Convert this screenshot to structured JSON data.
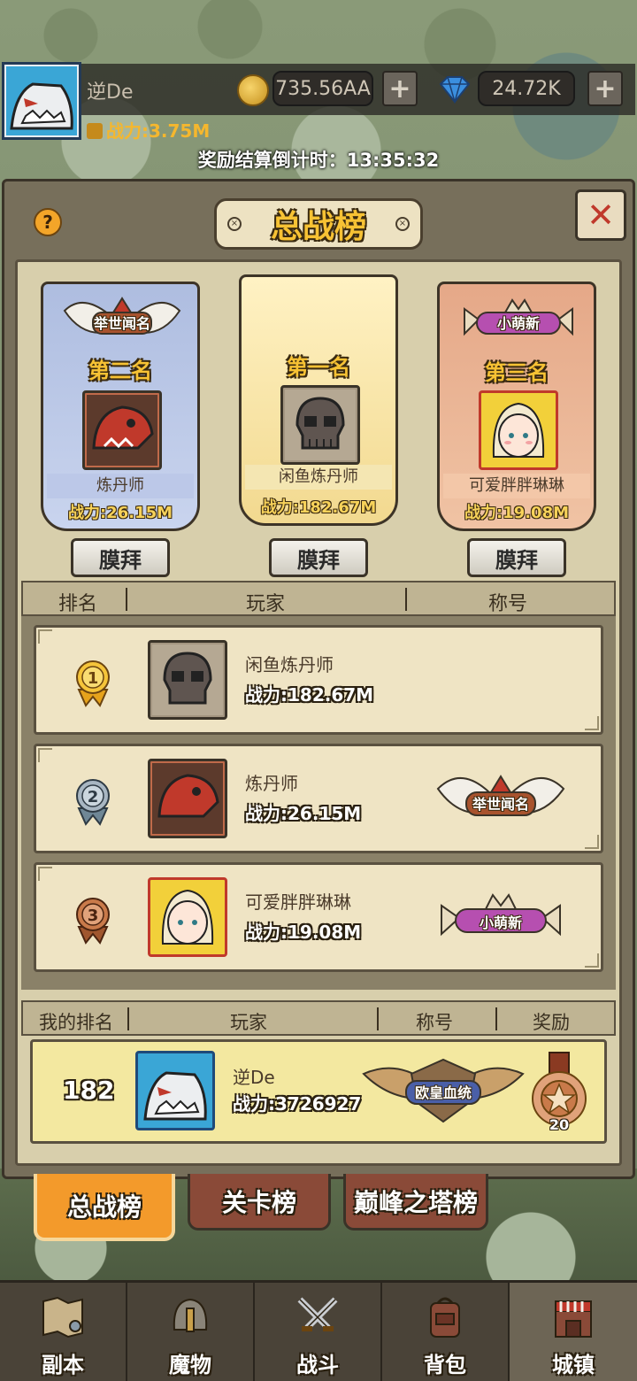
{
  "player": {
    "name": "逆De",
    "power": "战力:3.75M",
    "coins": "735.56AA",
    "gems": "24.72K"
  },
  "countdown": "奖励结算倒计时：13:35:32",
  "panel": {
    "title": "总战榜",
    "help": "?",
    "close": "✕"
  },
  "podium": [
    {
      "rank_label": "第二名",
      "name": "炼丹师",
      "power": "战力:26.15M",
      "title": "举世闻名",
      "worship": "膜拜"
    },
    {
      "rank_label": "第一名",
      "name": "闲鱼炼丹师",
      "power": "战力:182.67M",
      "title": "",
      "worship": "膜拜"
    },
    {
      "rank_label": "第三名",
      "name": "可爱胖胖琳琳",
      "power": "战力:19.08M",
      "title": "小萌新",
      "worship": "膜拜"
    }
  ],
  "table": {
    "headers": [
      "排名",
      "玩家",
      "称号"
    ],
    "rows": [
      {
        "rank": "1",
        "name": "闲鱼炼丹师",
        "power": "战力:182.67M",
        "title": ""
      },
      {
        "rank": "2",
        "name": "炼丹师",
        "power": "战力:26.15M",
        "title": "举世闻名"
      },
      {
        "rank": "3",
        "name": "可爱胖胖琳琳",
        "power": "战力:19.08M",
        "title": "小萌新"
      }
    ]
  },
  "my_rank": {
    "headers": [
      "我的排名",
      "玩家",
      "称号",
      "奖励"
    ],
    "rank": "182",
    "name": "逆De",
    "power": "战力:3726927",
    "title": "欧皇血统",
    "reward_count": "20"
  },
  "tabs": [
    "总战榜",
    "关卡榜",
    "巅峰之塔榜"
  ],
  "nav": [
    "副本",
    "魔物",
    "战斗",
    "背包",
    "城镇"
  ],
  "colors": {
    "accent": "#f39a2b",
    "gold_text": "#f7c234",
    "panel": "#d8cfac",
    "close_x": "#c0392b"
  }
}
